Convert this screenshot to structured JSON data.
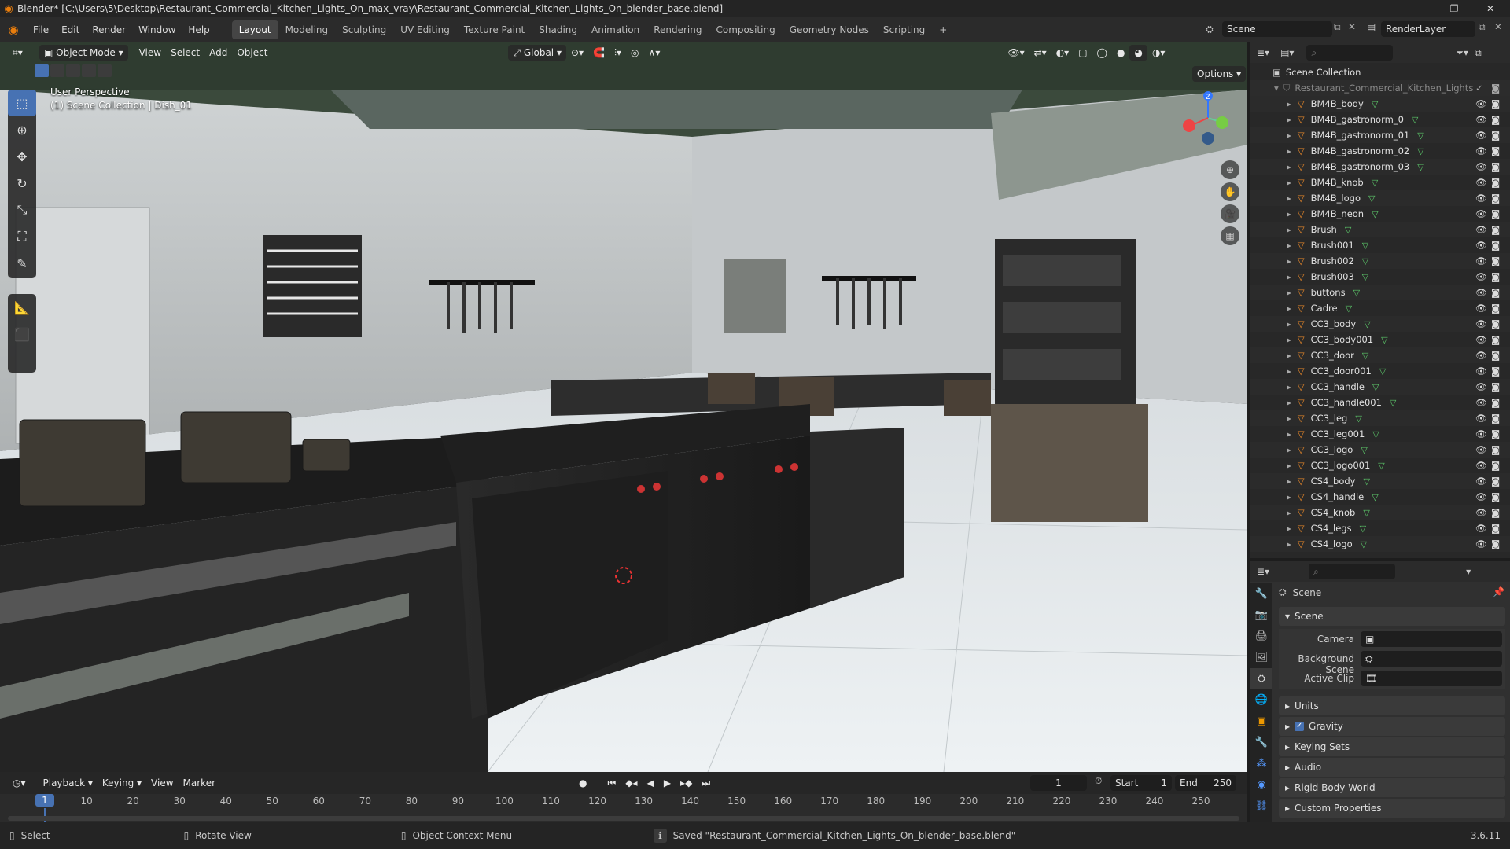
{
  "window": {
    "title": "Blender* [C:\\Users\\5\\Desktop\\Restaurant_Commercial_Kitchen_Lights_On_max_vray\\Restaurant_Commercial_Kitchen_Lights_On_blender_base.blend]",
    "minimize": "—",
    "maximize": "❐",
    "close": "✕"
  },
  "menu": [
    "File",
    "Edit",
    "Render",
    "Window",
    "Help"
  ],
  "workspaces": [
    {
      "label": "Layout",
      "active": true
    },
    {
      "label": "Modeling"
    },
    {
      "label": "Sculpting"
    },
    {
      "label": "UV Editing"
    },
    {
      "label": "Texture Paint"
    },
    {
      "label": "Shading"
    },
    {
      "label": "Animation"
    },
    {
      "label": "Rendering"
    },
    {
      "label": "Compositing"
    },
    {
      "label": "Geometry Nodes"
    },
    {
      "label": "Scripting"
    },
    {
      "label": "+"
    }
  ],
  "scene_selector": {
    "value": "Scene"
  },
  "view_layer": {
    "value": "RenderLayer"
  },
  "viewport": {
    "mode": "Object Mode",
    "menus": [
      "View",
      "Select",
      "Add",
      "Object"
    ],
    "transform_orientation": "Global",
    "options_label": "Options",
    "overlay_title": "User Perspective",
    "overlay_subtitle": "(1) Scene Collection | Dish_01",
    "gizmo_z": "Z"
  },
  "outliner": {
    "root": "Scene Collection",
    "collection": "Restaurant_Commercial_Kitchen_Lights",
    "items": [
      "BM4B_body",
      "BM4B_gastronorm_0",
      "BM4B_gastronorm_01",
      "BM4B_gastronorm_02",
      "BM4B_gastronorm_03",
      "BM4B_knob",
      "BM4B_logo",
      "BM4B_neon",
      "Brush",
      "Brush001",
      "Brush002",
      "Brush003",
      "buttons",
      "Cadre",
      "CC3_body",
      "CC3_body001",
      "CC3_door",
      "CC3_door001",
      "CC3_handle",
      "CC3_handle001",
      "CC3_leg",
      "CC3_leg001",
      "CC3_logo",
      "CC3_logo001",
      "CS4_body",
      "CS4_handle",
      "CS4_knob",
      "CS4_legs",
      "CS4_logo"
    ]
  },
  "properties": {
    "breadcrumb": "Scene",
    "panel_title": "Scene",
    "fields": [
      {
        "label": "Camera",
        "value": ""
      },
      {
        "label": "Background Scene",
        "value": ""
      },
      {
        "label": "Active Clip",
        "value": ""
      }
    ],
    "sections": [
      "Units",
      "Gravity",
      "Keying Sets",
      "Audio",
      "Rigid Body World",
      "Custom Properties"
    ],
    "gravity_checked": true
  },
  "timeline": {
    "menus": [
      "Playback",
      "Keying",
      "View",
      "Marker"
    ],
    "current_frame": "1",
    "start_label": "Start",
    "start": "1",
    "end_label": "End",
    "end": "250",
    "ticks": [
      "1",
      "10",
      "20",
      "30",
      "40",
      "50",
      "60",
      "70",
      "80",
      "90",
      "100",
      "110",
      "120",
      "130",
      "140",
      "150",
      "160",
      "170",
      "180",
      "190",
      "200",
      "210",
      "220",
      "230",
      "240",
      "250"
    ]
  },
  "status": {
    "select": "Select",
    "rotate": "Rotate View",
    "context": "Object Context Menu",
    "message": "Saved \"Restaurant_Commercial_Kitchen_Lights_On_blender_base.blend\"",
    "version": "3.6.11"
  }
}
